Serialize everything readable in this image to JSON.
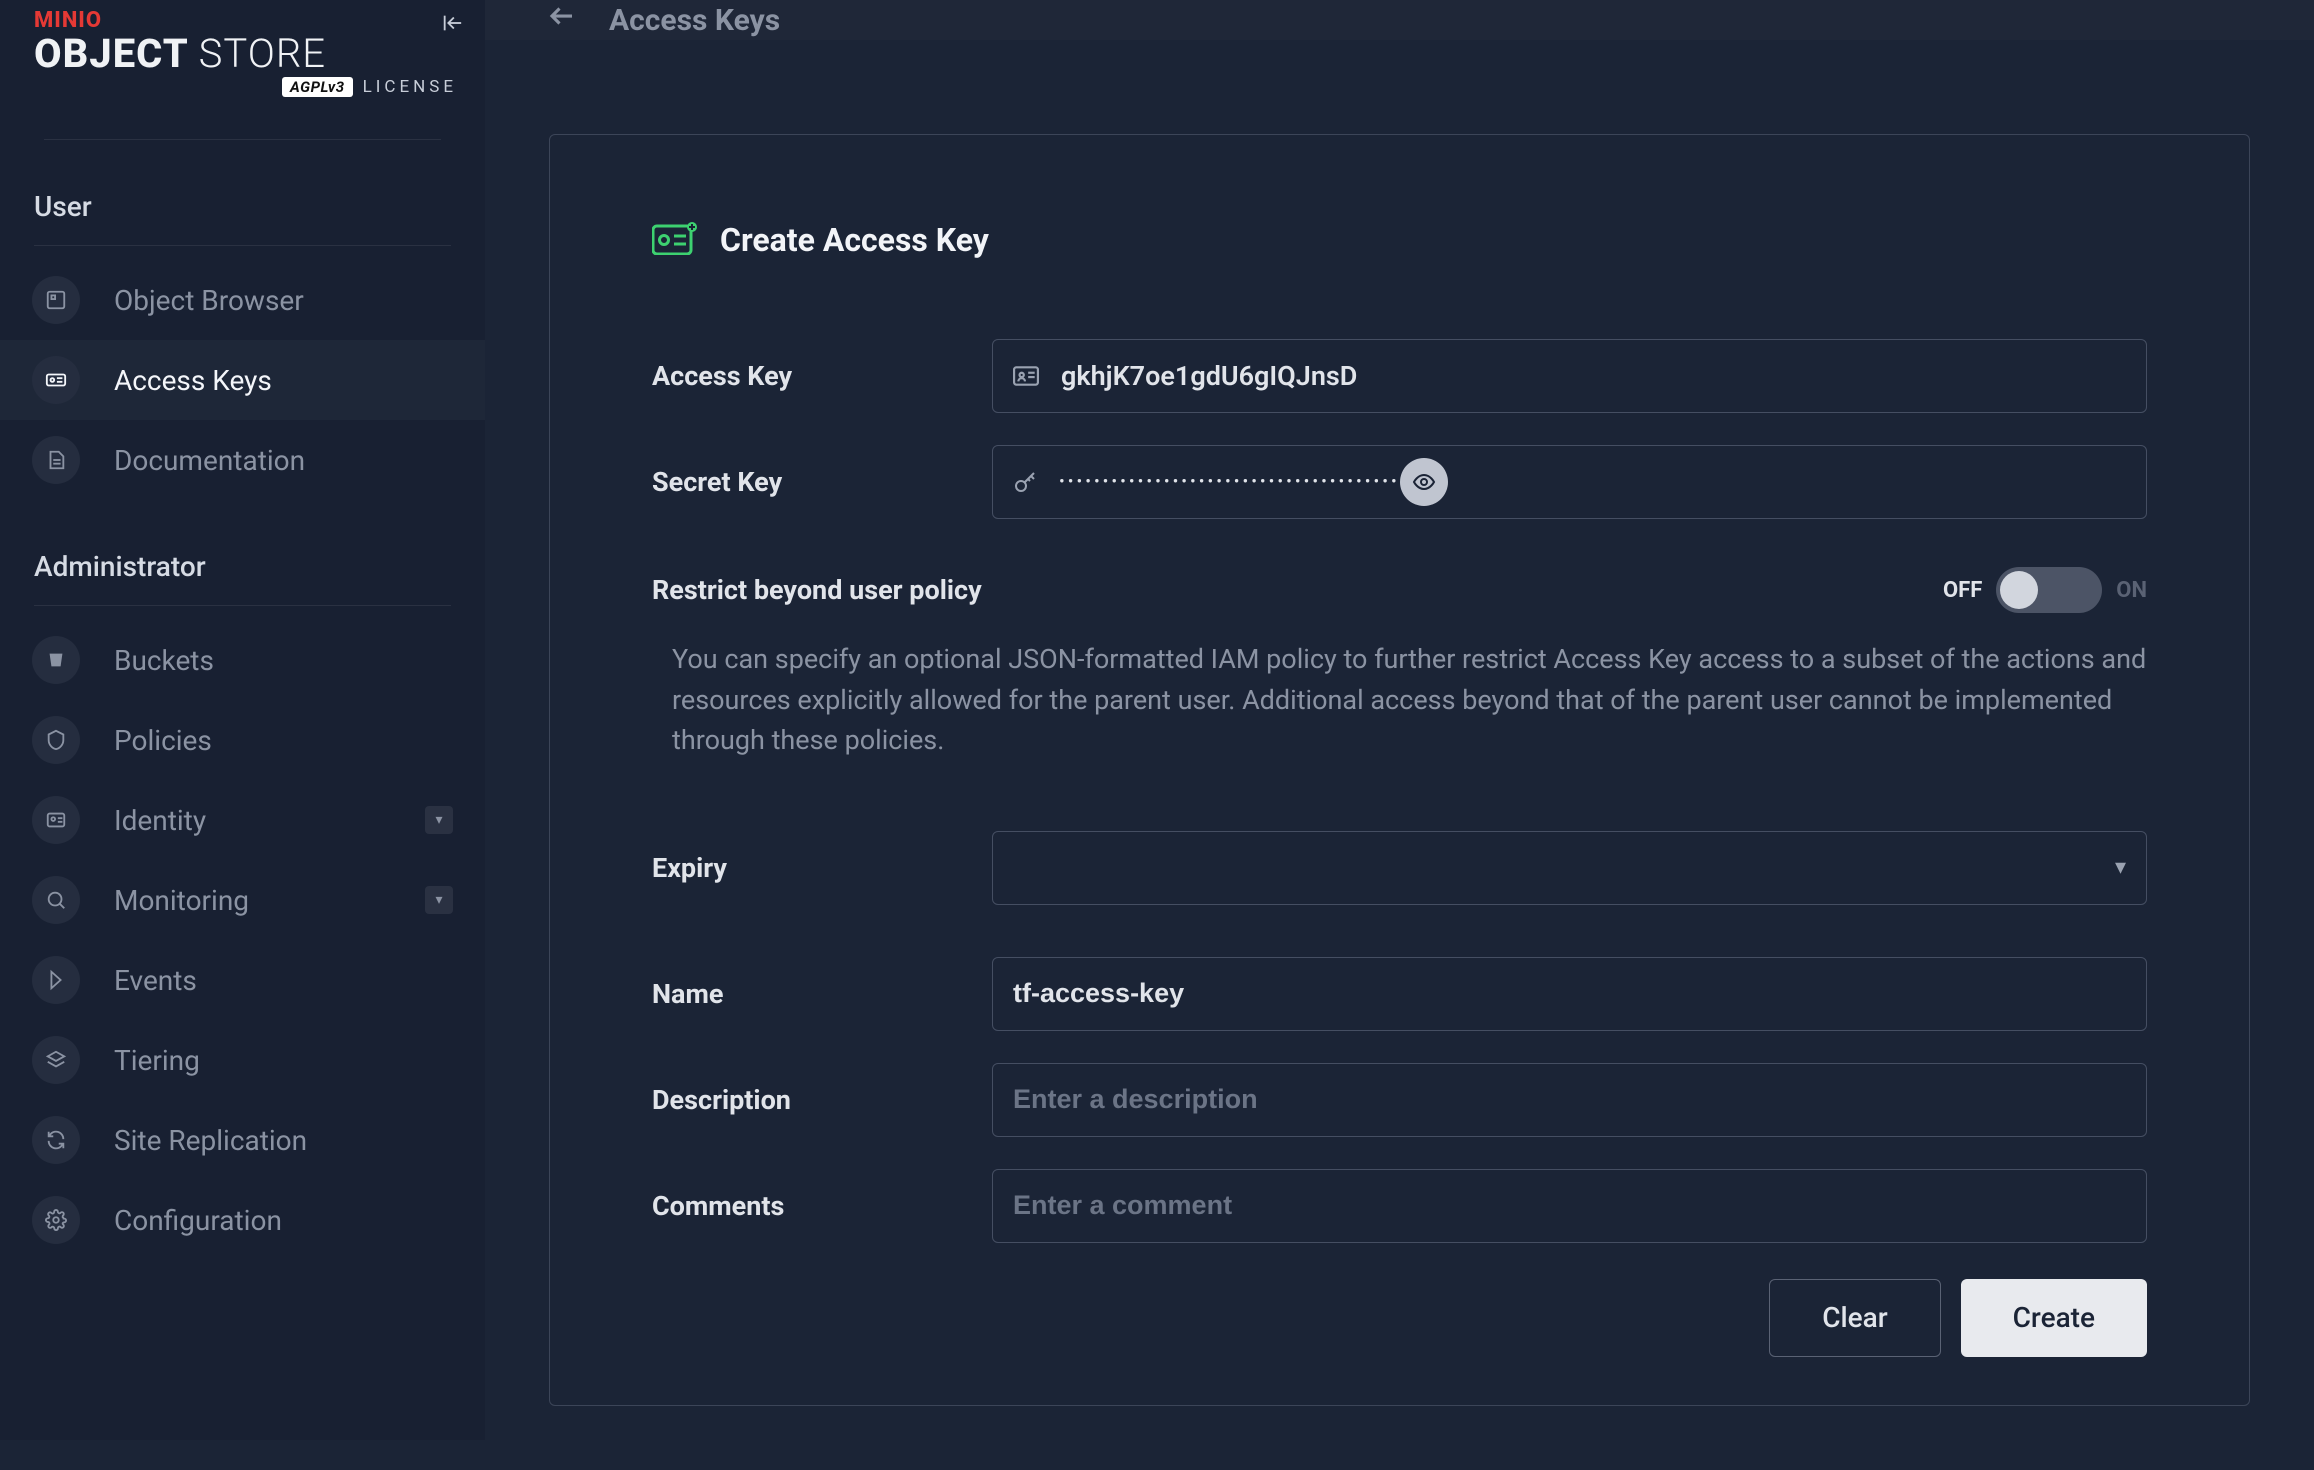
{
  "brand": {
    "minio": "MINIO",
    "object": "OBJECT",
    "store": "STORE",
    "agpl": "AGPLv3",
    "license": "LICENSE"
  },
  "sidebar": {
    "user_section": "User",
    "admin_section": "Administrator",
    "user_items": [
      {
        "label": "Object Browser"
      },
      {
        "label": "Access Keys"
      },
      {
        "label": "Documentation"
      }
    ],
    "admin_items": [
      {
        "label": "Buckets"
      },
      {
        "label": "Policies"
      },
      {
        "label": "Identity",
        "has_submenu": true
      },
      {
        "label": "Monitoring",
        "has_submenu": true
      },
      {
        "label": "Events"
      },
      {
        "label": "Tiering"
      },
      {
        "label": "Site Replication"
      },
      {
        "label": "Configuration"
      }
    ]
  },
  "topbar": {
    "title": "Access Keys"
  },
  "card": {
    "title": "Create Access Key"
  },
  "form": {
    "access_key_label": "Access Key",
    "access_key_value": "gkhjK7oe1gdU6gIQJnsD",
    "secret_key_label": "Secret Key",
    "secret_key_dots": "•••••••••••••••••••••••••••••••••••••••",
    "restrict_label": "Restrict beyond user policy",
    "off_label": "OFF",
    "on_label": "ON",
    "restrict_desc": "You can specify an optional JSON-formatted IAM policy to further restrict Access Key access to a subset of the actions and resources explicitly allowed for the parent user. Additional access beyond that of the parent user cannot be implemented through these policies.",
    "expiry_label": "Expiry",
    "name_label": "Name",
    "name_value": "tf-access-key",
    "description_label": "Description",
    "description_placeholder": "Enter a description",
    "comments_label": "Comments",
    "comments_placeholder": "Enter a comment"
  },
  "buttons": {
    "clear": "Clear",
    "create": "Create"
  }
}
